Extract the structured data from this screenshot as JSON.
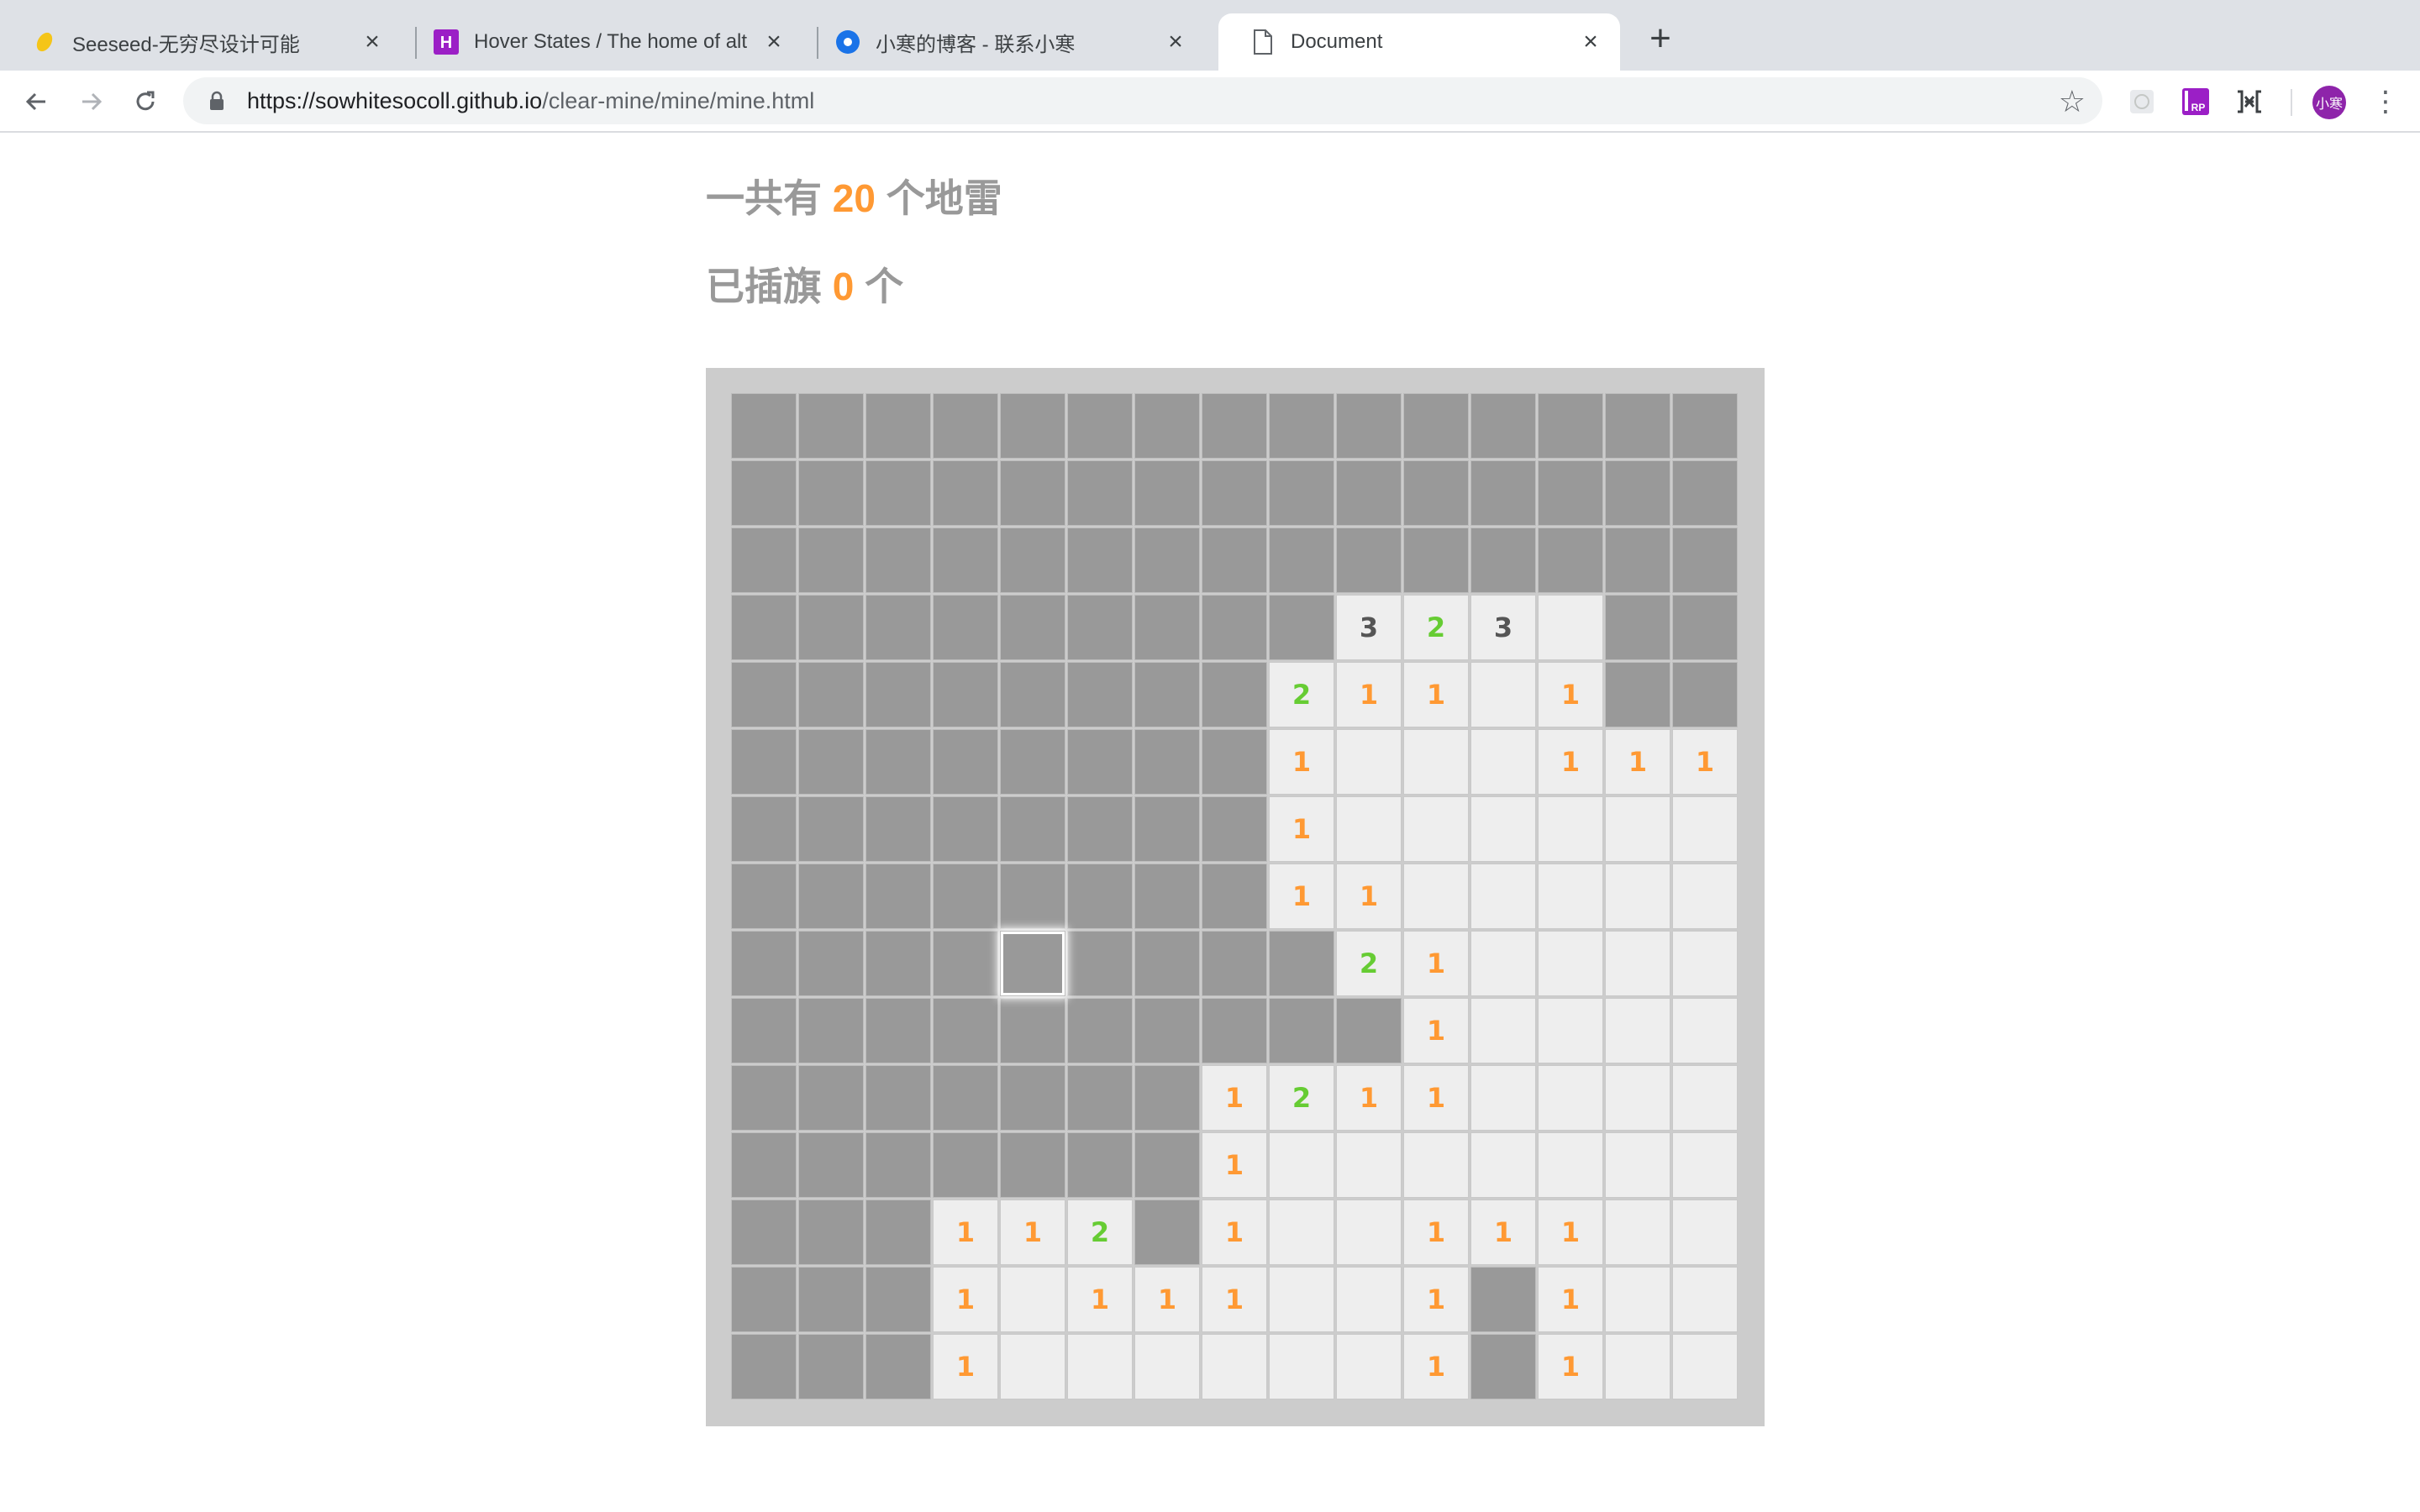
{
  "browser": {
    "tabs": [
      {
        "title": "Seeseed-无穷尽设计可能",
        "icon": "seeseed-favicon-icon"
      },
      {
        "title": "Hover States / The home of alt",
        "icon": "hover-states-favicon-icon"
      },
      {
        "title": "小寒的博客 - 联系小寒",
        "icon": "blog-favicon-icon"
      },
      {
        "title": "Document",
        "icon": "document-icon"
      }
    ],
    "active_tab": 3,
    "url_host": "https://sowhitesocoll.github.io",
    "url_path": "/clear-mine/mine/mine.html",
    "avatar_label": "小寒"
  },
  "game": {
    "mines_prefix": "一共有",
    "mines_total": "20",
    "mines_suffix": "个地雷",
    "flags_prefix": "已插旗",
    "flags_count": "0",
    "flags_suffix": "个",
    "rows": 15,
    "cols": 15,
    "hover_cell": [
      8,
      4
    ],
    "grid": [
      "###############",
      "###############",
      "###############",
      "#########323.##",
      "########211.1##",
      "########1...111",
      "########1......",
      "########11.....",
      "#########21....",
      "##########1....",
      "#######1211....",
      "#######1.......",
      "###112#1..111..",
      "###1.111..1#1..",
      "###1......1#1.."
    ],
    "number_colors": {
      "1": "#ff9933",
      "2": "#66cc33",
      "3": "#555555"
    }
  },
  "colors": {
    "hidden_cell": "#999999",
    "open_cell": "#eeeeee",
    "board_frame": "#cccccc",
    "label_gray": "#999999",
    "accent_orange": "#ff9933"
  }
}
